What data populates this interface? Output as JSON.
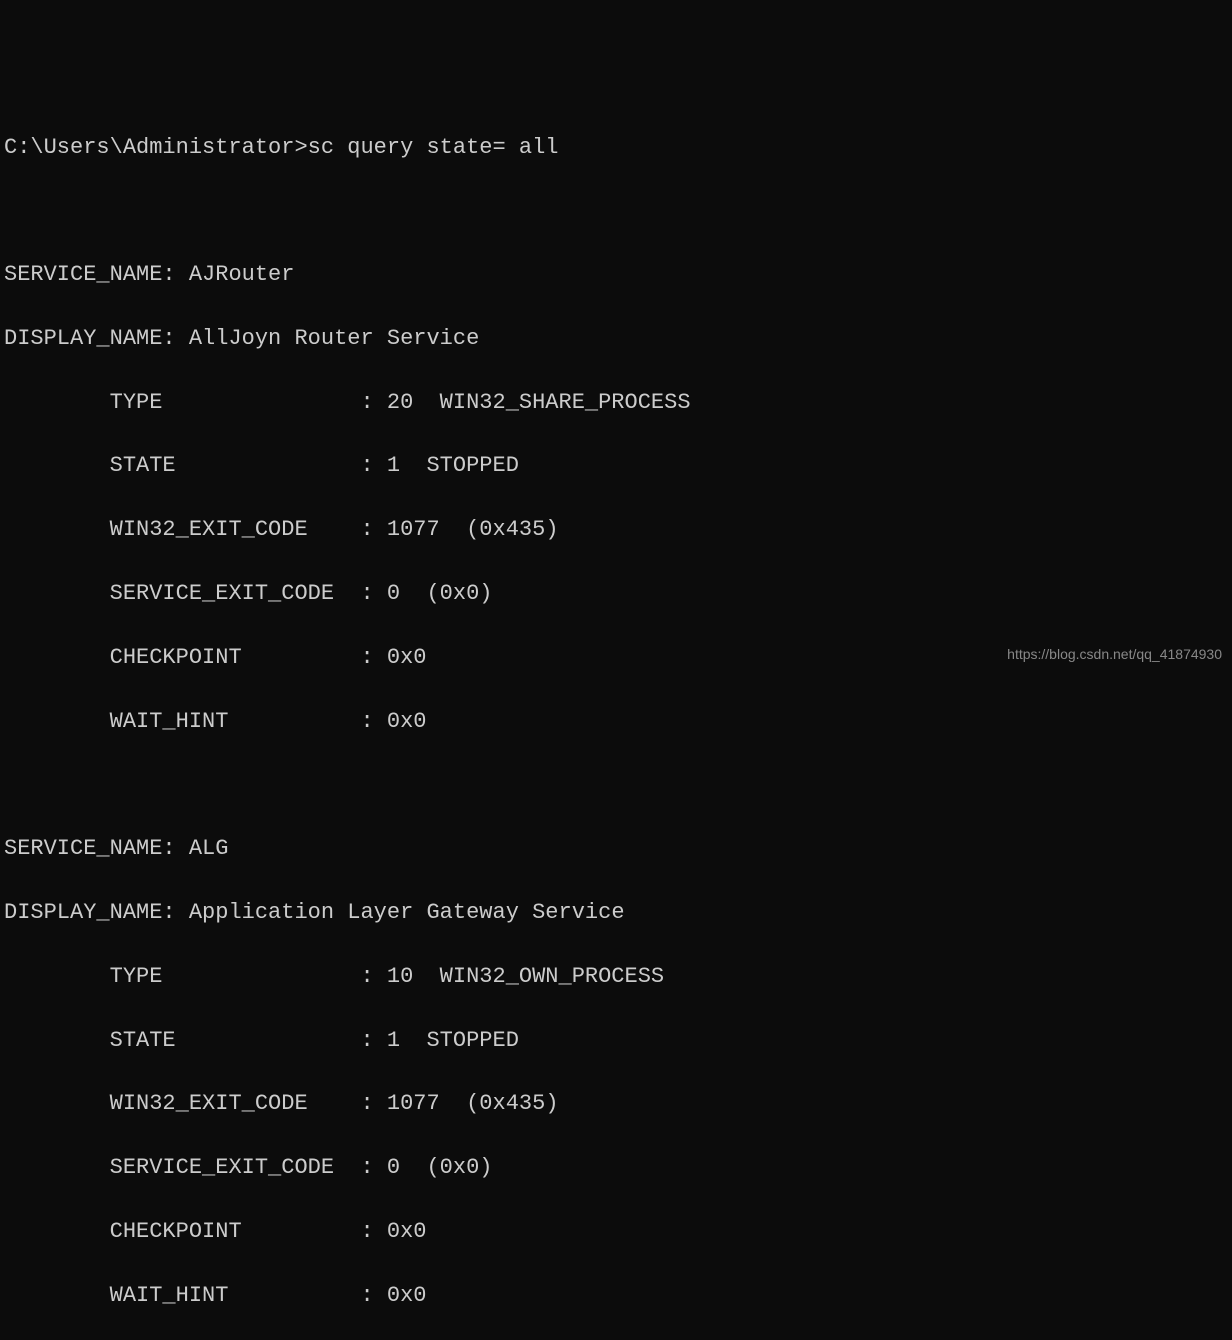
{
  "prompt": {
    "path": "C:\\Users\\Administrator>",
    "command": "sc query state= all"
  },
  "services": [
    {
      "service_name_label": "SERVICE_NAME:",
      "service_name_value": "AJRouter",
      "display_name_label": "DISPLAY_NAME:",
      "display_name_value": "AllJoyn Router Service",
      "fields": [
        {
          "label": "TYPE",
          "value": "20  WIN32_SHARE_PROCESS"
        },
        {
          "label": "STATE",
          "value": "1  STOPPED"
        },
        {
          "label": "WIN32_EXIT_CODE",
          "value": "1077  (0x435)"
        },
        {
          "label": "SERVICE_EXIT_CODE",
          "value": "0  (0x0)"
        },
        {
          "label": "CHECKPOINT",
          "value": "0x0"
        },
        {
          "label": "WAIT_HINT",
          "value": "0x0"
        }
      ]
    },
    {
      "service_name_label": "SERVICE_NAME:",
      "service_name_value": "ALG",
      "display_name_label": "DISPLAY_NAME:",
      "display_name_value": "Application Layer Gateway Service",
      "fields": [
        {
          "label": "TYPE",
          "value": "10  WIN32_OWN_PROCESS"
        },
        {
          "label": "STATE",
          "value": "1  STOPPED"
        },
        {
          "label": "WIN32_EXIT_CODE",
          "value": "1077  (0x435)"
        },
        {
          "label": "SERVICE_EXIT_CODE",
          "value": "0  (0x0)"
        },
        {
          "label": "CHECKPOINT",
          "value": "0x0"
        },
        {
          "label": "WAIT_HINT",
          "value": "0x0"
        }
      ]
    }
  ],
  "watermark": "https://blog.csdn.net/qq_41874930"
}
